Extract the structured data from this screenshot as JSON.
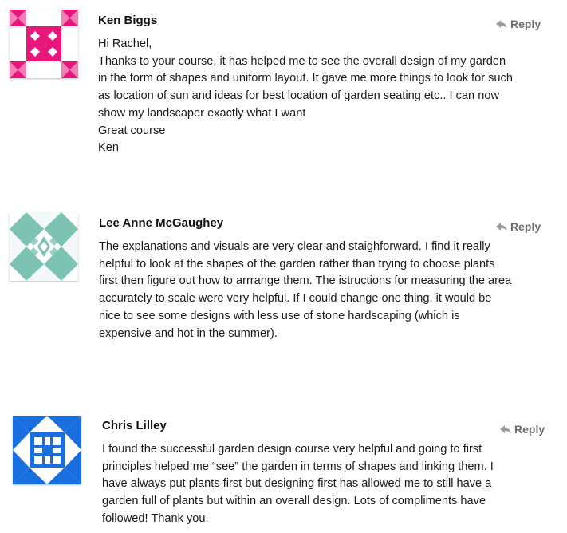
{
  "comments": [
    {
      "author": "Ken Biggs",
      "reply_label": "Reply",
      "avatar_icon": "pink-geometric-identicon",
      "avatar_color": "#e8157a",
      "lines": [
        "Hi Rachel,",
        "Thanks to your course, it has helped me to see the overall design of my garden",
        "in the form of shapes and uniform layout. It gave me more things to look for such",
        "as location of sun and ideas for best location of garden seating etc.. I can now",
        "show my landscaper exactly what I want",
        "Great course",
        "Ken"
      ]
    },
    {
      "author": "Lee Anne McGaughey",
      "reply_label": "Reply",
      "avatar_icon": "teal-geometric-identicon",
      "avatar_color": "#7cc3b4",
      "lines": [
        "The explanations and visuals are very clear and staighforward. I find it really",
        "helpful to look at the shapes of the garden rather than trying to choose plants",
        "first then figure out how to arrrange them. The istructions for measuring the area",
        "accurately to scale were very helpful. If I could change one thing, it would be",
        "nice to see some designs with less use of stone hardscaping (which is",
        "expensive and hot in the summer)."
      ]
    },
    {
      "author": "Chris Lilley",
      "reply_label": "Reply",
      "avatar_icon": "blue-geometric-identicon",
      "avatar_color": "#1a6fe0",
      "lines": [
        "I found the successful garden design course very helpful and going to first",
        "principles helped me “see” the garden in terms of shapes and linking them. I",
        "have always put plants first but designing first has allowed me to still have a",
        "garden full of plants but within an overall design. Lots of compliments have",
        "followed! Thank you."
      ]
    }
  ]
}
